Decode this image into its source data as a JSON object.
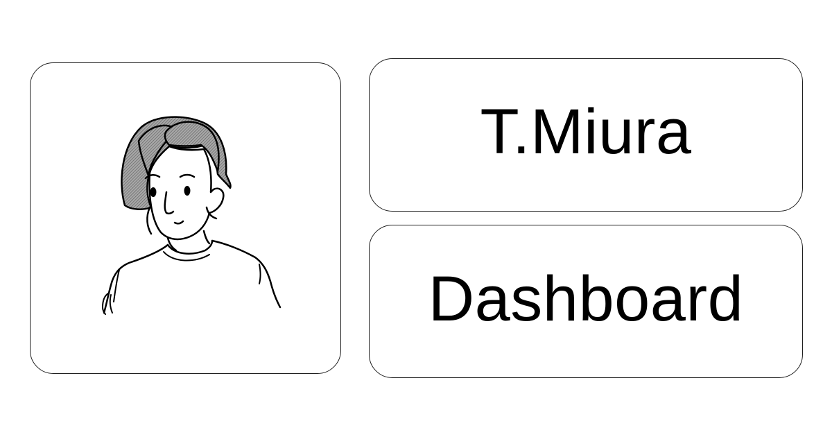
{
  "profile": {
    "avatar_icon": "person-avatar-icon",
    "name": "T.Miura"
  },
  "nav": {
    "dashboard_label": "Dashboard"
  },
  "colors": {
    "border": "#1f1f1f",
    "background": "#ffffff",
    "hair": "#8a8a8a",
    "text": "#000000"
  }
}
